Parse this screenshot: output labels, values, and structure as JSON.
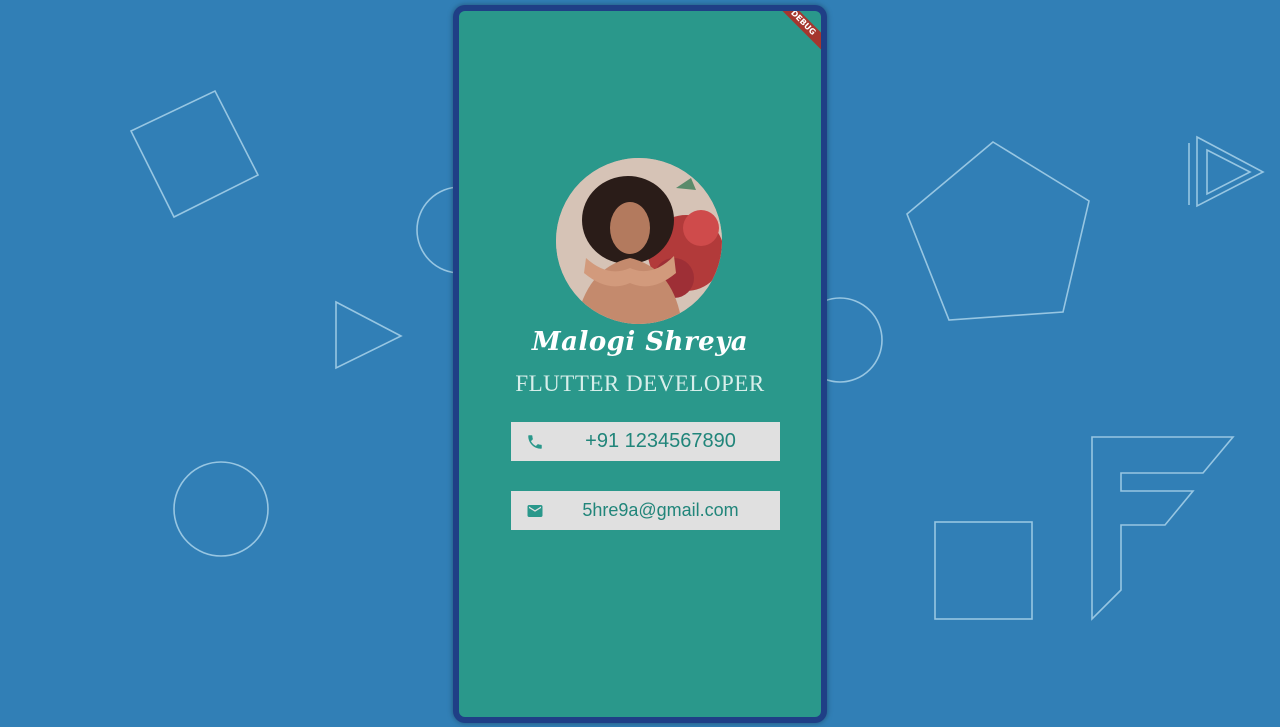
{
  "background": {
    "color": "#317fb6",
    "shapes": [
      "square",
      "circle",
      "triangle",
      "pentagon",
      "play-triangle",
      "flutter-logo-outline"
    ]
  },
  "app": {
    "debug_banner": "DEBUG",
    "screen_color": "#2a988b",
    "profile": {
      "avatar": "profile-photo",
      "name": "Malogi Shreya",
      "title": "FLUTTER DEVELOPER"
    },
    "contacts": {
      "phone": {
        "icon": "phone-icon",
        "value": "+91 1234567890"
      },
      "email": {
        "icon": "mail-icon",
        "value": "5hre9a@gmail.com"
      }
    }
  }
}
